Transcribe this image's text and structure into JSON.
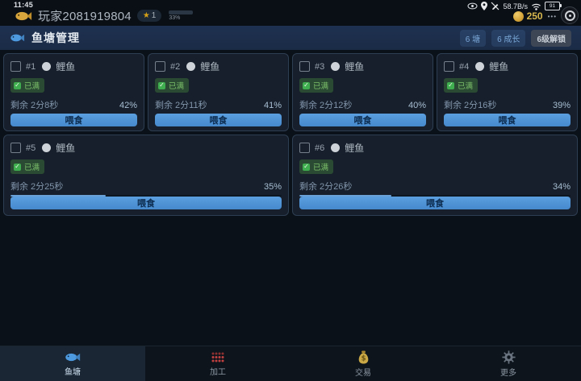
{
  "status_bar": {
    "time": "11:45",
    "network_speed": "58.7B/s",
    "battery_level": "91"
  },
  "player": {
    "name": "玩家2081919804",
    "star_level": "1",
    "xp_percent_label": "33%",
    "xp_value": 33,
    "coins": "250",
    "menu_dots": "•••"
  },
  "header": {
    "title": "鱼塘管理",
    "badges": [
      {
        "label": "6 塘"
      },
      {
        "label": "6 成长"
      },
      {
        "label": "6级解锁"
      }
    ]
  },
  "ponds": {
    "status_label": "已满",
    "feed_label": "喂食",
    "cards": [
      {
        "id": "#1",
        "fish": "鲤鱼",
        "remaining": "剩余 2分8秒",
        "percent": "42%",
        "value": 42,
        "wide": false
      },
      {
        "id": "#2",
        "fish": "鲤鱼",
        "remaining": "剩余 2分11秒",
        "percent": "41%",
        "value": 41,
        "wide": false
      },
      {
        "id": "#3",
        "fish": "鲤鱼",
        "remaining": "剩余 2分12秒",
        "percent": "40%",
        "value": 40,
        "wide": false
      },
      {
        "id": "#4",
        "fish": "鲤鱼",
        "remaining": "剩余 2分16秒",
        "percent": "39%",
        "value": 39,
        "wide": false
      },
      {
        "id": "#5",
        "fish": "鲤鱼",
        "remaining": "剩余 2分25秒",
        "percent": "35%",
        "value": 35,
        "wide": true
      },
      {
        "id": "#6",
        "fish": "鲤鱼",
        "remaining": "剩余 2分26秒",
        "percent": "34%",
        "value": 34,
        "wide": true
      }
    ]
  },
  "tabs": [
    {
      "label": "鱼塘",
      "icon": "fish-icon",
      "active": true
    },
    {
      "label": "加工",
      "icon": "machine-icon",
      "active": false
    },
    {
      "label": "交易",
      "icon": "money-bag-icon",
      "active": false
    },
    {
      "label": "更多",
      "icon": "gear-icon",
      "active": false
    }
  ],
  "colors": {
    "background": "#0b1119",
    "header_bar": "#1c2d48",
    "card_background": "#161f2b",
    "accent_blue": "#4f96d8",
    "progress_fill": "#6aa2d8",
    "success_green": "#3fae4e",
    "coin_gold": "#d4a93f",
    "machine_red": "#b24040",
    "xp_teal": "#4fb0a0"
  }
}
